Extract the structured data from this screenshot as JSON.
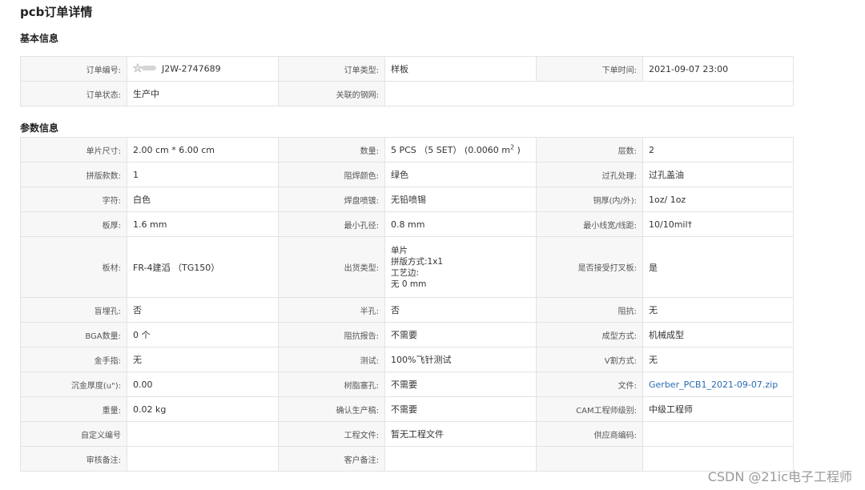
{
  "page_title": "pcb订单详情",
  "basic": {
    "section_title": "基本信息",
    "order_no_label": "订单编号:",
    "order_no": "J2W-2747689",
    "order_type_label": "订单类型:",
    "order_type": "样板",
    "order_time_label": "下单时间:",
    "order_time": "2021-09-07 23:00",
    "status_label": "订单状态:",
    "status": "生产中",
    "stencil_label": "关联的钢网:",
    "stencil": ""
  },
  "params": {
    "section_title": "参数信息",
    "rows": [
      [
        [
          "单片尺寸:",
          "2.00 cm * 6.00 cm"
        ],
        [
          "数量:",
          "5 PCS （5 SET） (0.0060 m"
        ],
        [
          "层数:",
          "2"
        ]
      ],
      [
        [
          "拼版款数:",
          "1"
        ],
        [
          "阻焊颜色:",
          "绿色"
        ],
        [
          "过孔处理:",
          "过孔盖油"
        ]
      ],
      [
        [
          "字符:",
          "白色"
        ],
        [
          "焊盘喷镀:",
          "无铅喷锡"
        ],
        [
          "铜厚(内/外):",
          "1oz/ 1oz"
        ]
      ],
      [
        [
          "板厚:",
          "1.6 mm"
        ],
        [
          "最小孔径:",
          "0.8 mm"
        ],
        [
          "最小线宽/线距:",
          "10/10mil†"
        ]
      ],
      [
        [
          "板材:",
          "FR-4建滔 （TG150）"
        ],
        [
          "出货类型:",
          ""
        ],
        [
          "是否接受打叉板:",
          "是"
        ]
      ],
      [
        [
          "盲埋孔:",
          "否"
        ],
        [
          "半孔:",
          "否"
        ],
        [
          "阻抗:",
          "无"
        ]
      ],
      [
        [
          "BGA数量:",
          "0 个"
        ],
        [
          "阻抗报告:",
          "不需要"
        ],
        [
          "成型方式:",
          "机械成型"
        ]
      ],
      [
        [
          "金手指:",
          "无"
        ],
        [
          "测试:",
          "100%飞针测试"
        ],
        [
          "V割方式:",
          "无"
        ]
      ],
      [
        [
          "沉金厚度(u\"):",
          "0.00"
        ],
        [
          "树脂塞孔:",
          "不需要"
        ],
        [
          "文件:",
          "Gerber_PCB1_2021-09-07.zip"
        ]
      ],
      [
        [
          "重量:",
          "0.02 kg"
        ],
        [
          "确认生产稿:",
          "不需要"
        ],
        [
          "CAM工程师级别:",
          "中级工程师"
        ]
      ],
      [
        [
          "自定义编号",
          ""
        ],
        [
          "工程文件:",
          "暂无工程文件"
        ],
        [
          "供应商编码:",
          ""
        ]
      ],
      [
        [
          "审核备注:",
          ""
        ],
        [
          "客户备注:",
          ""
        ],
        [
          "",
          ""
        ]
      ]
    ],
    "quantity_sup": "2",
    "quantity_tail": " )",
    "shipping_lines": [
      "单片",
      "拼版方式:1x1",
      "工艺边:",
      "无 0 mm"
    ]
  },
  "watermark": "CSDN @21ic电子工程师",
  "colors": {
    "link": "#2a6cb4",
    "label_bg": "#f7f7f7",
    "border": "#e3e3e3"
  },
  "icons": {
    "order_badge": "star-badge-icon"
  }
}
